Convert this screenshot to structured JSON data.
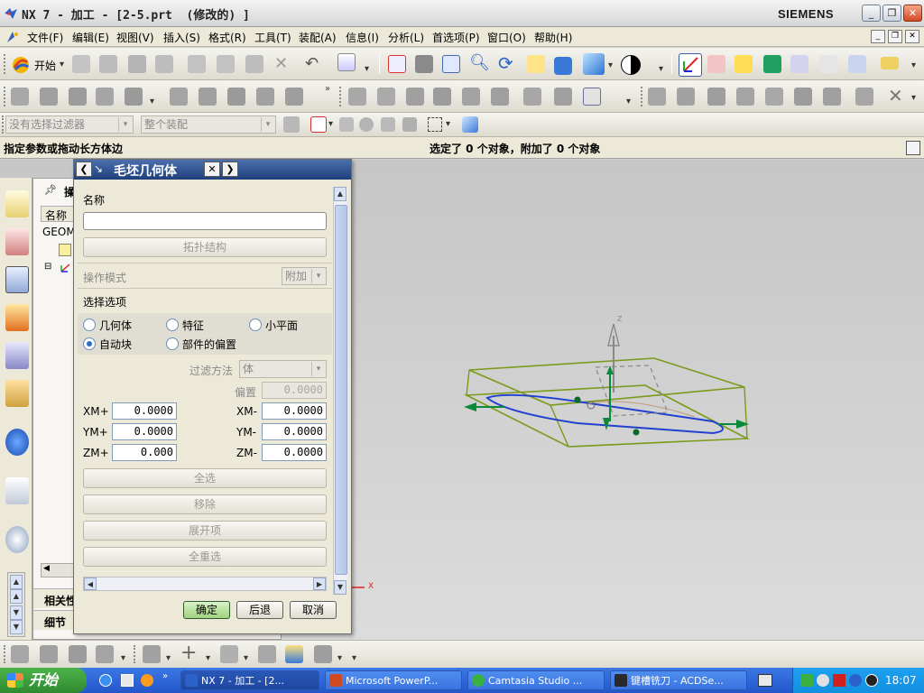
{
  "window": {
    "title": "NX 7 - 加工 - [2-5.prt  (修改的) ]",
    "brand": "SIEMENS"
  },
  "menu": {
    "items": [
      "文件(F)",
      "编辑(E)",
      "视图(V)",
      "插入(S)",
      "格式(R)",
      "工具(T)",
      "装配(A)",
      "信息(I)",
      "分析(L)",
      "首选项(P)",
      "窗口(O)",
      "帮助(H)"
    ]
  },
  "toolbar": {
    "start_label": "开始",
    "filter_placeholder": "没有选择过滤器",
    "scope_value": "整个装配"
  },
  "status": {
    "prompt": "指定参数或拖动长方体边",
    "selection": "选定了 0 个对象，附加了 0 个对象"
  },
  "navigator": {
    "title": "操",
    "column_name": "名称",
    "row_geom": "GEOM",
    "bottom_tab_related": "相关性",
    "bottom_tab_details": "细节"
  },
  "dialog": {
    "title": "毛坯几何体",
    "name_label": "名称",
    "name_value": "",
    "topology_button": "拓扑结构",
    "operation_mode_label": "操作模式",
    "operation_mode_value": "附加",
    "selection_options_label": "选择选项",
    "radio_geometry": "几何体",
    "radio_feature": "特征",
    "radio_facet": "小平面",
    "radio_autoblock": "自动块",
    "radio_offset": "部件的偏置",
    "selected_option": "自动块",
    "filter_method_label": "过滤方法",
    "filter_method_value": "体",
    "offset_label": "偏置",
    "offset_value": "0.0000",
    "xm_plus_label": "XM+",
    "xm_plus_value": "0.0000",
    "ym_plus_label": "YM+",
    "ym_plus_value": "0.0000",
    "zm_plus_label": "ZM+",
    "zm_plus_value": "0.000",
    "xm_minus_label": "XM-",
    "xm_minus_value": "0.0000",
    "ym_minus_label": "YM-",
    "ym_minus_value": "0.0000",
    "zm_minus_label": "ZM-",
    "zm_minus_value": "0.0000",
    "select_all_button": "全选",
    "remove_button": "移除",
    "expand_button": "展开项",
    "reselect_all_button": "全重选",
    "ok_button": "确定",
    "back_button": "后退",
    "cancel_button": "取消"
  },
  "graphics": {
    "axis_z": "Z",
    "axis_x": "X"
  },
  "taskbar": {
    "start_label": "开始",
    "tasks": [
      "NX 7 - 加工 - [2...",
      "Microsoft PowerP...",
      "Camtasia Studio ...",
      "键槽铣刀 - ACDSe..."
    ],
    "clock": "18:07"
  },
  "colors": {
    "dialog_header": "#1f3f7a",
    "wireframe_block": "#7a9a1a",
    "part_outline": "#2040d0",
    "axis_green": "#0a8a3a",
    "taskbar_blue": "#2456c9"
  }
}
